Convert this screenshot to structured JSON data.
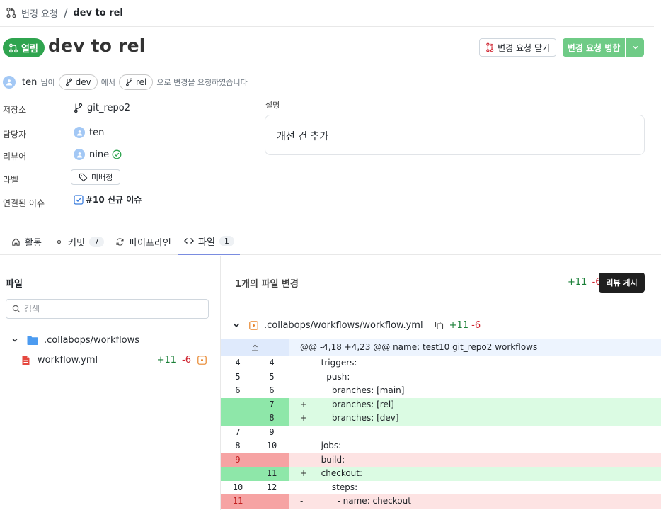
{
  "breadcrumb": {
    "parent": "변경 요청",
    "separator": "/",
    "current": "dev to rel"
  },
  "header": {
    "status": "열림",
    "title": "dev to rel",
    "close_label": "변경 요청 닫기",
    "merge_label": "변경 요청 병합"
  },
  "request": {
    "user": "ten",
    "user_suffix": "님이",
    "source_branch": "dev",
    "mid": "에서",
    "target_branch": "rel",
    "tail": "으로 변경을 요청하였습니다"
  },
  "meta": {
    "repo_label": "저장소",
    "repo": "git_repo2",
    "assignee_label": "담당자",
    "assignee": "ten",
    "reviewer_label": "리뷰어",
    "reviewer": "nine",
    "label_label": "라벨",
    "label": "미배정",
    "issue_label": "연결된 이슈",
    "issue": "#10 신규 이슈"
  },
  "description": {
    "label": "설명",
    "text": "개선 건 추가"
  },
  "tabs": [
    {
      "label": "활동",
      "count": ""
    },
    {
      "label": "커밋",
      "count": "7"
    },
    {
      "label": "파이프라인",
      "count": ""
    },
    {
      "label": "파일",
      "count": "1"
    }
  ],
  "files": {
    "title": "파일",
    "search_placeholder": "검색",
    "folder": ".collabops/workflows",
    "file": "workflow.yml",
    "file_add": "+11",
    "file_del": "-6"
  },
  "changes": {
    "title": "1개의 파일 변경",
    "add": "+11",
    "del": "-6",
    "review_label": "리뷰 게시",
    "path": ".collabops/workflows/workflow.yml",
    "path_add": "+11",
    "path_del": "-6"
  },
  "diff": {
    "hunk": "@@ -4,18 +4,23 @@ name: test10 git_repo2 workflows",
    "lines": [
      {
        "type": "ctx",
        "old": "4",
        "new": "4",
        "mark": "",
        "text": "  triggers:"
      },
      {
        "type": "ctx",
        "old": "5",
        "new": "5",
        "mark": "",
        "text": "    push:"
      },
      {
        "type": "ctx",
        "old": "6",
        "new": "6",
        "mark": "",
        "text": "      branches: [main]"
      },
      {
        "type": "add",
        "old": "",
        "new": "7",
        "mark": "+",
        "text": "      branches: [rel]"
      },
      {
        "type": "add",
        "old": "",
        "new": "8",
        "mark": "+",
        "text": "      branches: [dev]"
      },
      {
        "type": "ctx",
        "old": "7",
        "new": "9",
        "mark": "",
        "text": ""
      },
      {
        "type": "ctx",
        "old": "8",
        "new": "10",
        "mark": "",
        "text": "  jobs:"
      },
      {
        "type": "del",
        "old": "9",
        "new": "",
        "mark": "-",
        "text": "  build:"
      },
      {
        "type": "add",
        "old": "",
        "new": "11",
        "mark": "+",
        "text": "  checkout:"
      },
      {
        "type": "ctx",
        "old": "10",
        "new": "12",
        "mark": "",
        "text": "      steps:"
      },
      {
        "type": "del",
        "old": "11",
        "new": "",
        "mark": "-",
        "text": "        - name: checkout"
      }
    ]
  },
  "colors": {
    "open": "#2fa44f",
    "merge": "#6fcb86",
    "add": "#1a7f37",
    "del": "#cf222e",
    "tab_active": "#7a8ce0"
  }
}
